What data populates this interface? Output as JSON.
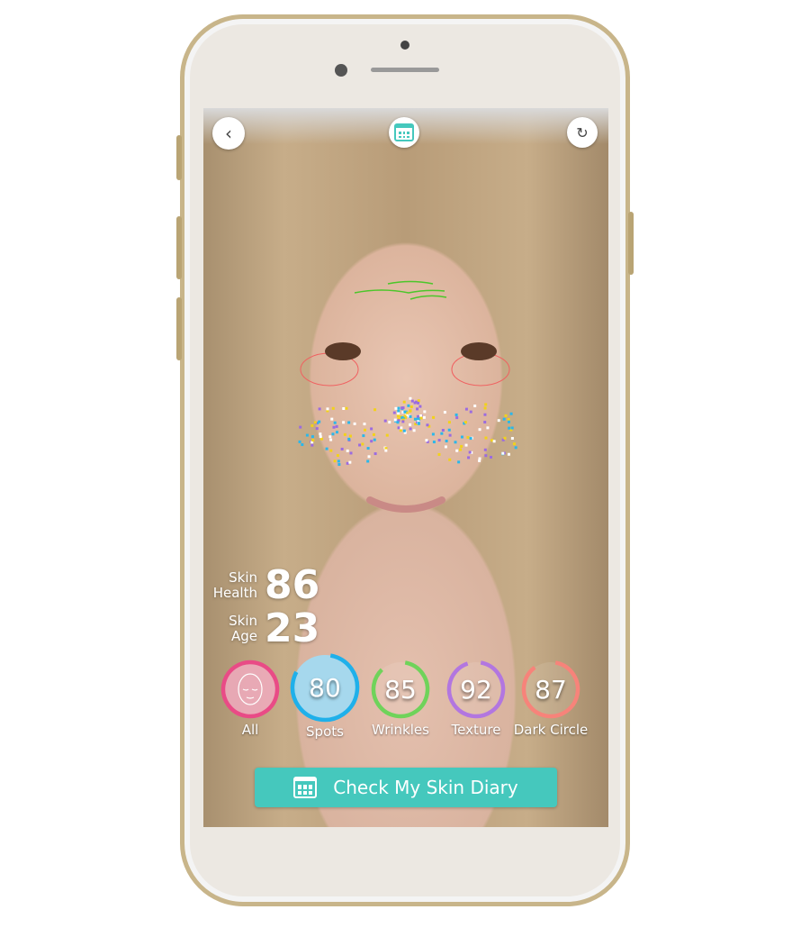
{
  "header": {
    "back_icon": "chevron-left-icon",
    "diary_icon": "calendar-icon",
    "camera_icon": "camera-switch-icon"
  },
  "scores": {
    "health_label_1": "Skin",
    "health_label_2": "Health",
    "health_value": "86",
    "age_label_1": "Skin",
    "age_label_2": "Age",
    "age_value": "23"
  },
  "categories": [
    {
      "label": "All",
      "value": "",
      "color": "#e94b86",
      "progress": 100
    },
    {
      "label": "Spots",
      "value": "80",
      "color": "#1fb0ea",
      "progress": 80
    },
    {
      "label": "Wrinkles",
      "value": "85",
      "color": "#6fd35a",
      "progress": 85
    },
    {
      "label": "Texture",
      "value": "92",
      "color": "#b276e0",
      "progress": 92
    },
    {
      "label": "Dark Circle",
      "value": "87",
      "color": "#f7837a",
      "progress": 87
    }
  ],
  "diary_button": {
    "label": "Check My Skin Diary",
    "color": "#45c8bd"
  }
}
